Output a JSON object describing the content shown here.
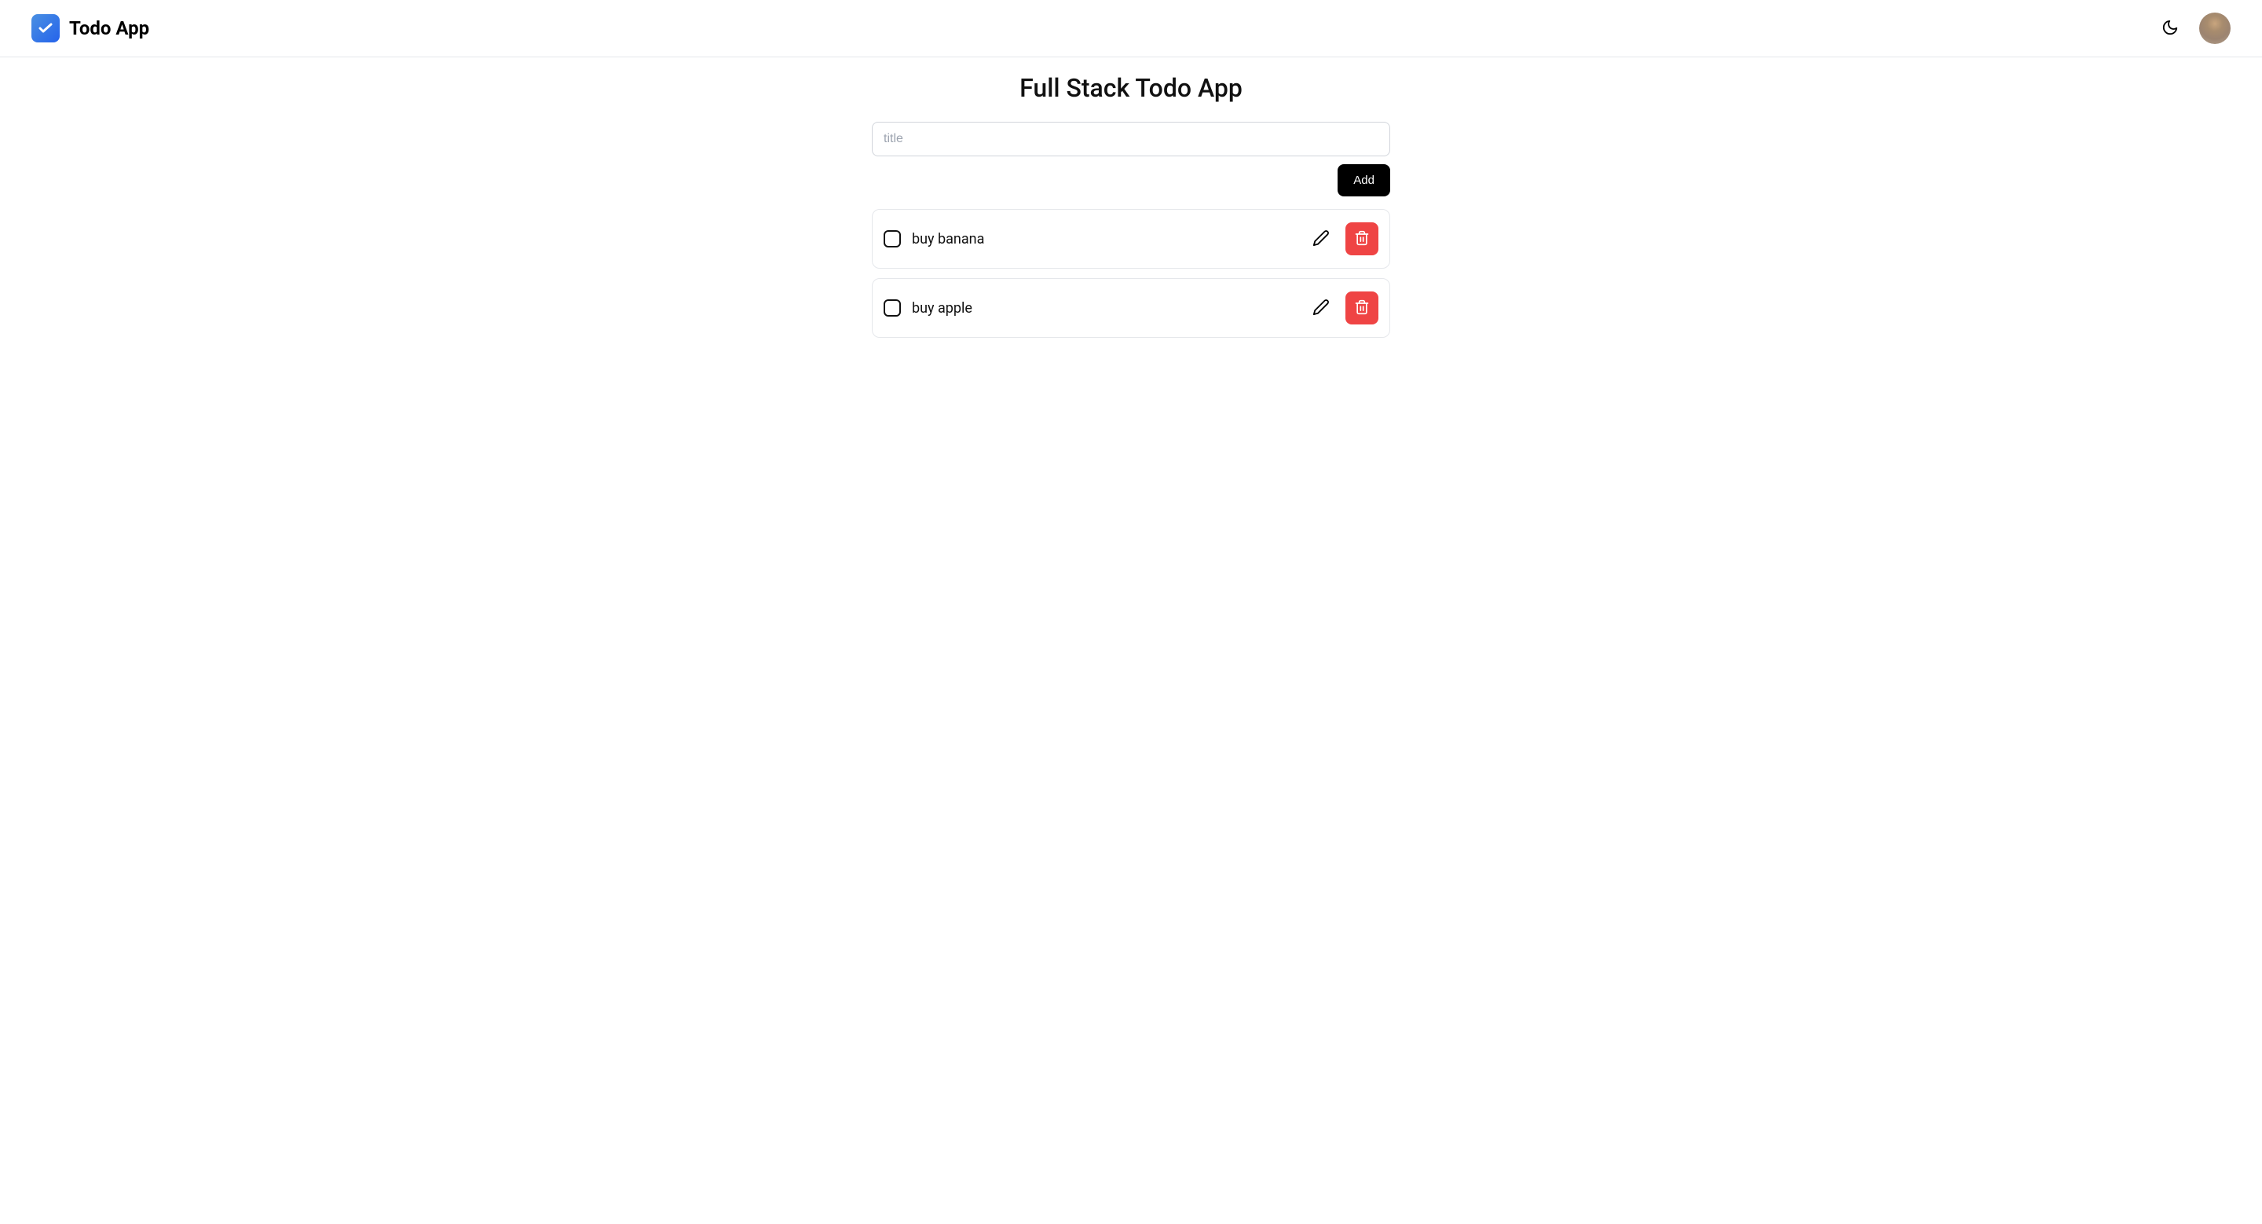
{
  "header": {
    "app_name": "Todo App"
  },
  "main": {
    "page_title": "Full Stack Todo App",
    "input": {
      "placeholder": "title",
      "value": ""
    },
    "add_button_label": "Add"
  },
  "todos": [
    {
      "text": "buy banana",
      "checked": false
    },
    {
      "text": "buy apple",
      "checked": false
    }
  ]
}
